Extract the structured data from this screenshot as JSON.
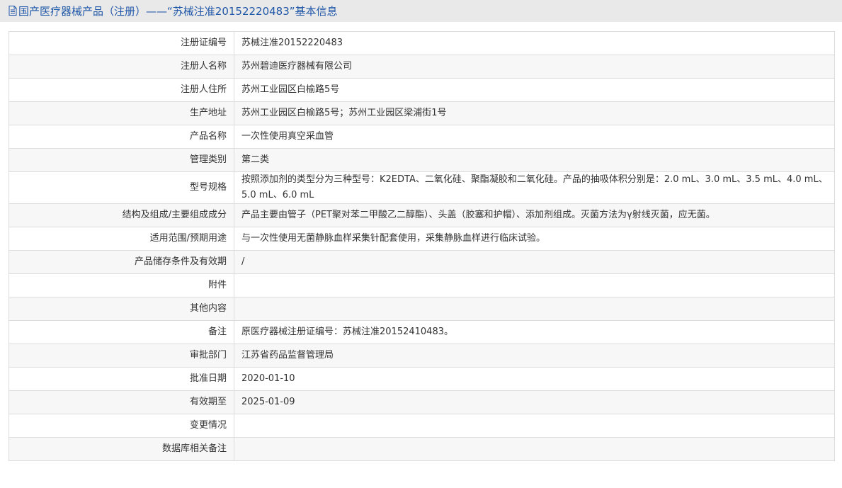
{
  "header": {
    "title": "国产医疗器械产品（注册）——“苏械注准20152220483”基本信息"
  },
  "rows": [
    {
      "label": "注册证编号",
      "value": "苏械注准20152220483"
    },
    {
      "label": "注册人名称",
      "value": "苏州碧迪医疗器械有限公司"
    },
    {
      "label": "注册人住所",
      "value": "苏州工业园区白榆路5号"
    },
    {
      "label": "生产地址",
      "value": "苏州工业园区白榆路5号；苏州工业园区梁浦街1号"
    },
    {
      "label": "产品名称",
      "value": "一次性使用真空采血管"
    },
    {
      "label": "管理类别",
      "value": "第二类"
    },
    {
      "label": "型号规格",
      "value": "按照添加剂的类型分为三种型号：K2EDTA、二氧化硅、聚酯凝胶和二氧化硅。产品的抽吸体积分别是：2.0 mL、3.0 mL、3.5 mL、4.0 mL、5.0 mL、6.0 mL"
    },
    {
      "label": "结构及组成/主要组成成分",
      "value": "产品主要由管子（PET聚对苯二甲酸乙二醇酯）、头盖（胶塞和护帽）、添加剂组成。灭菌方法为γ射线灭菌，应无菌。"
    },
    {
      "label": "适用范围/预期用途",
      "value": "与一次性使用无菌静脉血样采集针配套使用，采集静脉血样进行临床试验。"
    },
    {
      "label": "产品储存条件及有效期",
      "value": "/"
    },
    {
      "label": "附件",
      "value": ""
    },
    {
      "label": "其他内容",
      "value": ""
    },
    {
      "label": "备注",
      "value": "原医疗器械注册证编号：苏械注准20152410483。"
    },
    {
      "label": "审批部门",
      "value": "江苏省药品监督管理局"
    },
    {
      "label": "批准日期",
      "value": "2020-01-10"
    },
    {
      "label": "有效期至",
      "value": "2025-01-09"
    },
    {
      "label": "变更情况",
      "value": ""
    },
    {
      "label": "数据库相关备注",
      "value": ""
    }
  ]
}
